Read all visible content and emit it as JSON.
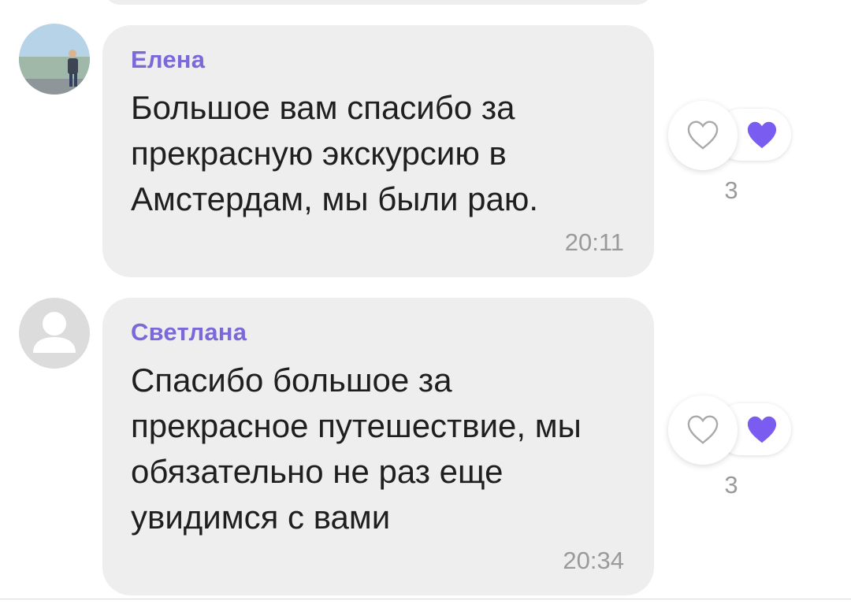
{
  "colors": {
    "accent": "#7b68d9",
    "bubble": "#eeeeef",
    "heart_fill": "#7b5cf0",
    "meta_text": "#9a9a9a"
  },
  "messages": [
    {
      "sender": "Елена",
      "text": "Большое вам спасибо за прекрасную экскурсию в Амстердам, мы были раю.",
      "time": "20:11",
      "likes": "3",
      "avatar_icon": "user-photo-avatar",
      "reaction_icon": "heart-icon"
    },
    {
      "sender": "Светлана",
      "text": "Спасибо большое за прекрасное путешествие, мы обязательно не раз еще увидимся с вами",
      "time": "20:34",
      "likes": "3",
      "avatar_icon": "default-user-avatar",
      "reaction_icon": "heart-icon"
    }
  ]
}
